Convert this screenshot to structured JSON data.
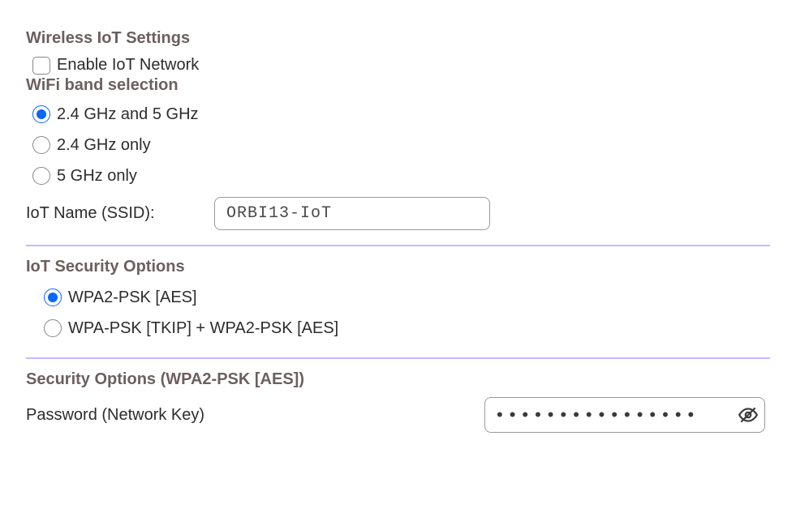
{
  "wireless": {
    "title": "Wireless IoT Settings",
    "enable_label": "Enable IoT Network",
    "enable_checked": false,
    "band_title": "WiFi band selection",
    "band_options": {
      "both": "2.4 GHz and 5 GHz",
      "only24": "2.4 GHz only",
      "only5": "5 GHz only"
    },
    "band_selected": "both",
    "ssid_label": "IoT Name (SSID):",
    "ssid_value": "ORBI13-IoT"
  },
  "security": {
    "title": "IoT Security Options",
    "options": {
      "wpa2": "WPA2-PSK [AES]",
      "mixed": "WPA-PSK [TKIP] + WPA2-PSK [AES]"
    },
    "selected": "wpa2"
  },
  "password": {
    "section_title": "Security Options (WPA2-PSK [AES])",
    "label": "Password (Network Key)",
    "value": "••••••••••••••••",
    "masked": true
  }
}
